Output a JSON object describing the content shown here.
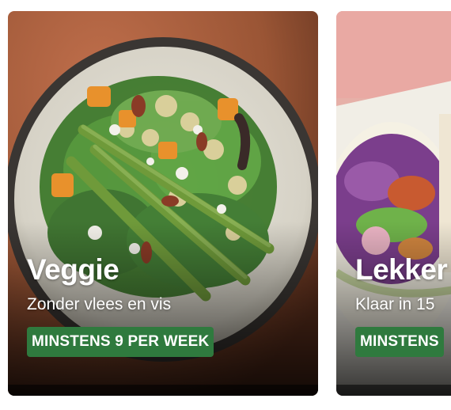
{
  "cards": [
    {
      "title": "Veggie",
      "subtitle": "Zonder vlees en vis",
      "badge": "MINSTENS 9 PER WEEK",
      "image": "veggie-salad-plate"
    },
    {
      "title": "Lekker",
      "subtitle": "Klaar in 15",
      "badge": "MINSTENS",
      "image": "wrap-with-red-cabbage"
    }
  ],
  "colors": {
    "badge": "#2f7a3e",
    "text": "#ffffff",
    "table": "#9a5535"
  }
}
